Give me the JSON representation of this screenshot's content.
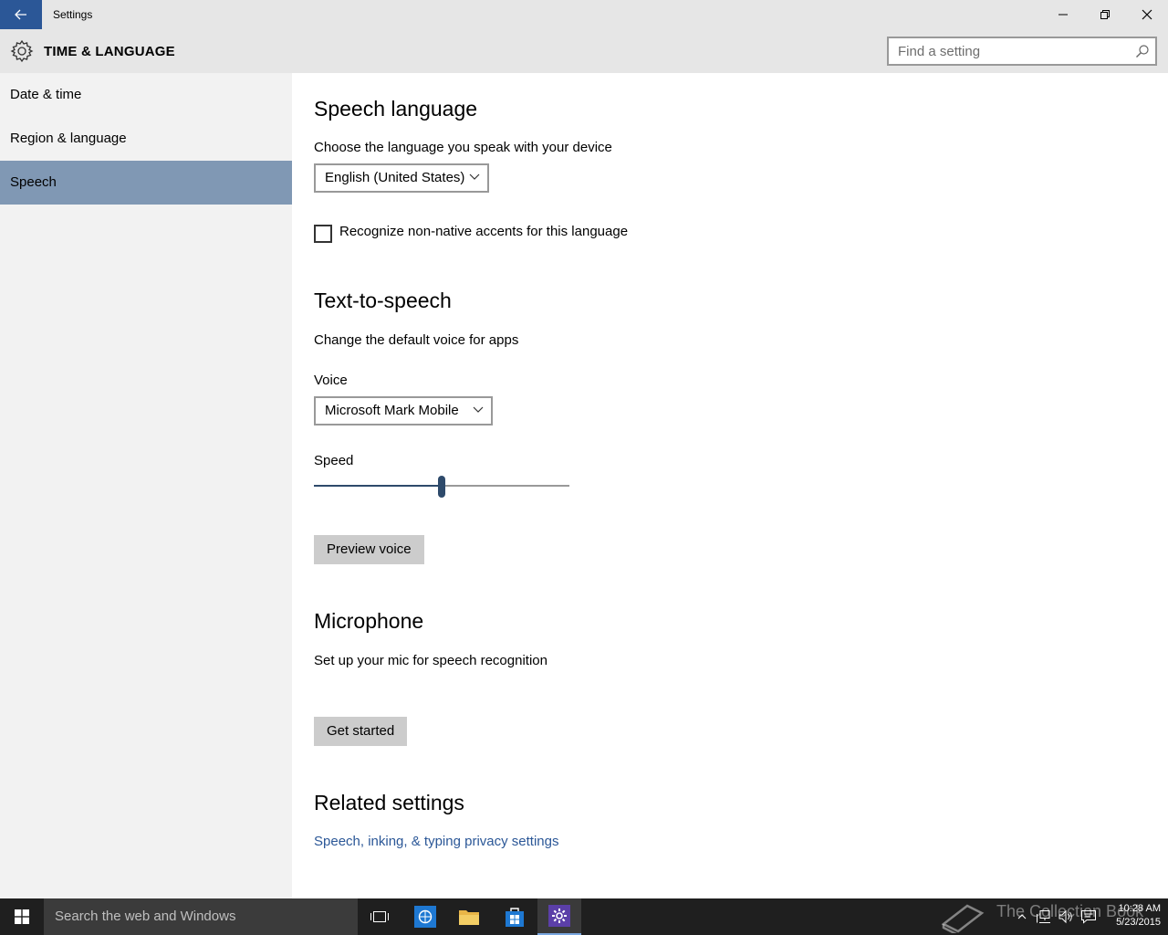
{
  "window": {
    "title": "Settings",
    "icons": {
      "back": "back-arrow-icon",
      "minimize": "minimize-icon",
      "maximize": "restore-icon",
      "close": "close-icon"
    }
  },
  "header": {
    "title": "TIME & LANGUAGE",
    "icon": "gear-icon",
    "search_placeholder": "Find a setting"
  },
  "sidebar": {
    "items": [
      {
        "label": "Date & time",
        "selected": false
      },
      {
        "label": "Region & language",
        "selected": false
      },
      {
        "label": "Speech",
        "selected": true
      }
    ]
  },
  "speech_language": {
    "heading": "Speech language",
    "description": "Choose the language you speak with your device",
    "language_value": "English (United States)",
    "accent_checkbox_label": "Recognize non-native accents for this language",
    "accent_checked": false
  },
  "tts": {
    "heading": "Text-to-speech",
    "description": "Change the default voice for apps",
    "voice_label": "Voice",
    "voice_value": "Microsoft Mark Mobile",
    "speed_label": "Speed",
    "speed_fraction": 0.5,
    "preview_button": "Preview voice"
  },
  "microphone": {
    "heading": "Microphone",
    "description": "Set up your mic for speech recognition",
    "button": "Get started"
  },
  "related": {
    "heading": "Related settings",
    "link": "Speech, inking, & typing privacy settings"
  },
  "taskbar": {
    "search_text": "Search the web and Windows",
    "apps": [
      "task-view-icon",
      "internet-explorer-icon",
      "file-explorer-icon",
      "store-icon",
      "settings-icon"
    ],
    "watermark": "The Collection Book",
    "time": "10:28 AM",
    "date": "5/23/2015"
  },
  "colors": {
    "accent": "#2b5797",
    "selected_nav": "#8098b4",
    "chrome": "#e6e6e6",
    "sidebar": "#f2f2f2"
  }
}
